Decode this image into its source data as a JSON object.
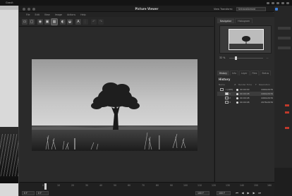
{
  "menubar": {
    "items": [
      "",
      "",
      "",
      "",
      "Gravit"
    ]
  },
  "window": {
    "title": "Picture Viewer",
    "view_label": "View Transform:",
    "view_value": "Untransformed",
    "menus": [
      "File",
      "Edit",
      "View",
      "Image",
      "Actions",
      "Help"
    ]
  },
  "toolbar": {
    "buttons": [
      {
        "name": "open-icon",
        "glyph": "▭"
      },
      {
        "name": "save-icon",
        "glyph": "▢"
      },
      {
        "name": "camera-icon",
        "glyph": "◉"
      },
      {
        "name": "fit-view-icon",
        "glyph": "▣"
      },
      {
        "name": "actual-size-icon",
        "glyph": "▦"
      },
      {
        "name": "contrast-icon",
        "glyph": "◐"
      },
      {
        "name": "color-picker-icon",
        "glyph": "◒"
      },
      {
        "name": "text-icon",
        "glyph": "A"
      },
      {
        "name": "grid-icon",
        "glyph": "⋮"
      },
      {
        "name": "undo-icon",
        "glyph": "↶"
      },
      {
        "name": "redo-icon",
        "glyph": "↷"
      }
    ]
  },
  "panel": {
    "top_tabs": [
      "Navigator",
      "Histogram"
    ],
    "zoom_value": "32 %",
    "zoom_mark": "—",
    "history_tabs": [
      "History",
      "Info",
      "Layer",
      "Files",
      "Status"
    ],
    "history_title": "History",
    "columns": [
      "Name",
      "#",
      "Render Time",
      "F",
      "Resolution"
    ],
    "rows": [
      {
        "name": "r (163)",
        "time": "00:00:00",
        "res": "4464x2976"
      },
      {
        "name": "1",
        "time": "00:00:08",
        "res": "4464x2976"
      },
      {
        "name": "2",
        "time": "00:00:08",
        "res": "4464x2976"
      },
      {
        "name": "3",
        "time": "00:00:08",
        "res": "2976x2976"
      }
    ]
  },
  "timeline": {
    "ticks": [
      "0",
      "10",
      "20",
      "30",
      "40",
      "50",
      "60",
      "70",
      "80",
      "90",
      "100",
      "110",
      "120",
      "130",
      "140",
      "150",
      "160"
    ],
    "start_field": "0 F",
    "start_field2": "0 F",
    "end_field": "100 F",
    "end_field2": "100 F",
    "status_text": "00:00:00 | 0 F | 100 F | 100 F"
  },
  "colors": {
    "accent": "#3d7fd9",
    "alert": "#c0392b"
  }
}
